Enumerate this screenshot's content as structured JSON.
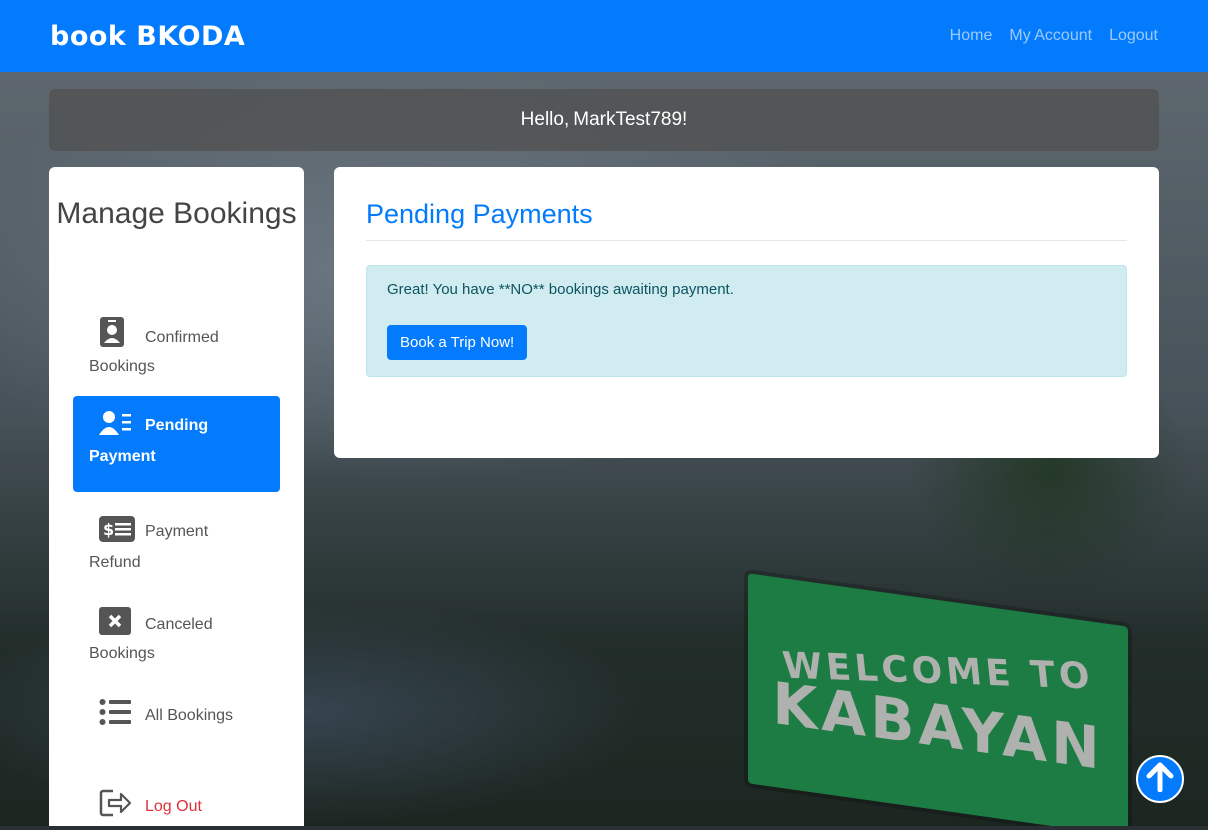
{
  "brand": "book BKODA",
  "nav": {
    "home": "Home",
    "account": "My Account",
    "logout": "Logout"
  },
  "greeting": {
    "prefix": "Hello,",
    "username": "MarkTest789",
    "suffix": "!"
  },
  "sidebar": {
    "title": "Manage Bookings",
    "items": [
      {
        "label": "Confirmed Bookings",
        "icon": "id-badge-icon"
      },
      {
        "label": "Pending Payment",
        "icon": "user-list-icon",
        "active": true
      },
      {
        "label": "Payment Refund",
        "icon": "money-check-icon"
      },
      {
        "label": "Canceled Bookings",
        "icon": "close-box-icon"
      },
      {
        "label": "All Bookings",
        "icon": "list-icon"
      },
      {
        "label": "Log Out",
        "icon": "sign-out-icon"
      }
    ]
  },
  "main": {
    "title": "Pending Payments",
    "alert_text": "Great! You have **NO** bookings awaiting payment.",
    "cta_label": "Book a Trip Now!"
  },
  "background": {
    "sign_line1": "WELCOME TO",
    "sign_line2": "KABAYAN"
  },
  "colors": {
    "primary": "#037bfc",
    "alert_bg": "#d1ecf1",
    "alert_text": "#0c5460",
    "logout": "#e0303a"
  }
}
